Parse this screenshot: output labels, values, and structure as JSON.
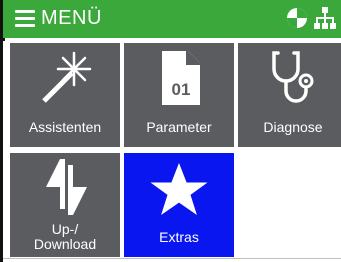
{
  "header": {
    "title": "MENÜ",
    "menu_icon": "hamburger-icon",
    "status_icons": [
      "contrast-circle-icon",
      "network-tree-icon"
    ],
    "bar_color": "#3aa83a"
  },
  "tiles": [
    {
      "label": "Assistenten",
      "icon": "magic-wand-icon",
      "selected": false
    },
    {
      "label": "Parameter",
      "icon": "document-01-icon",
      "badge": "01",
      "selected": false
    },
    {
      "label": "Diagnose",
      "icon": "stethoscope-icon",
      "selected": false
    },
    {
      "label": "Up-/\nDownload",
      "line1": "Up-/",
      "line2": "Download",
      "icon": "up-download-arrows-icon",
      "selected": false
    },
    {
      "label": "Extras",
      "icon": "star-icon",
      "selected": true
    }
  ],
  "colors": {
    "tile_default": "#5a5c5f",
    "tile_selected": "#0a16f0",
    "text": "#ffffff"
  }
}
